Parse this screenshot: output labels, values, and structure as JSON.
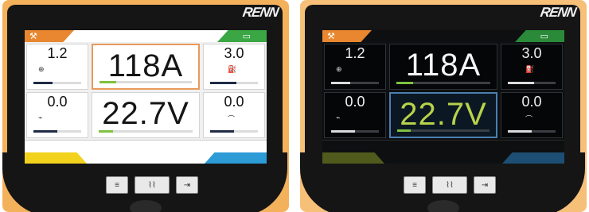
{
  "brand": "RENN",
  "panels": [
    {
      "theme": "light",
      "wire_speed": "1.2",
      "current": "118A",
      "inductance": "3.0",
      "arc_length": "0.0",
      "voltage": "22.7V",
      "trim": "0.0",
      "current_bar_fill": 0.18,
      "voltage_bar_fill": 0.15
    },
    {
      "theme": "dark",
      "wire_speed": "1.2",
      "current": "118A",
      "inductance": "3.0",
      "arc_length": "0.0",
      "voltage": "22.7V",
      "trim": "0.0",
      "current_bar_fill": 0.18,
      "voltage_bar_fill": 0.15
    }
  ],
  "icons": {
    "top_left": "welding-torch-icon",
    "top_right": "memory-icon",
    "wire": "wire-feed-icon",
    "gas": "gas-icon",
    "arc": "arc-icon",
    "dynamics": "dynamics-icon"
  },
  "colors": {
    "orange": "#e8872f",
    "green": "#3aa744",
    "yellow": "#f2d21c",
    "blue": "#2c9bd6",
    "voltage_dark": "#b8d24a"
  }
}
